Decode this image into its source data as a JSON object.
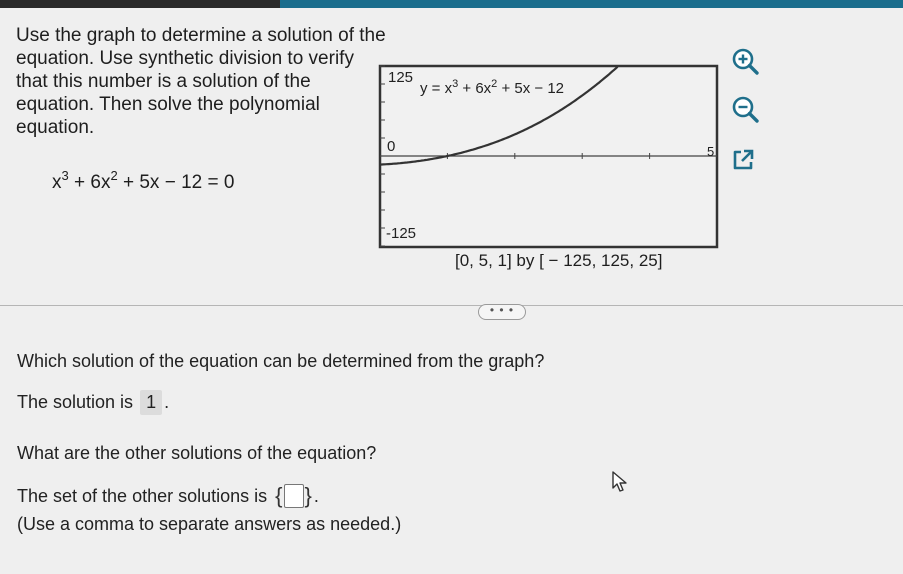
{
  "problem": {
    "instruction": "Use the graph to determine a solution of the equation. Use synthetic division to verify that this number is a solution of the equation. Then solve the polynomial equation.",
    "equation_parts": [
      "x",
      "3",
      " + 6x",
      "2",
      " + 5x − 12 = 0"
    ]
  },
  "graph": {
    "function_label_parts": [
      "y = x",
      "3",
      " + 6x",
      "2",
      " + 5x − 12"
    ],
    "y_max_label": "125",
    "y_zero_label": "0",
    "y_min_label": "-125",
    "x_max_label": "5",
    "window_label": "[0, 5, 1]  by  [ − 125, 125, 25]",
    "window": {
      "xmin": 0,
      "xmax": 5,
      "xscl": 1,
      "ymin": -125,
      "ymax": 125,
      "yscl": 25
    }
  },
  "toolbar": {
    "zoom_in": "zoom-in-icon",
    "zoom_out": "zoom-out-icon",
    "popout": "external-link-icon"
  },
  "more_button": "• • •",
  "question1": {
    "text": "Which solution of the equation can be determined from the graph?",
    "answer_prefix": "The solution is",
    "answer_value": "1",
    "answer_suffix": "."
  },
  "question2": {
    "text": "What are the other solutions of the equation?",
    "answer_prefix": "The set of the other solutions is",
    "set_open": "{",
    "set_close": "}",
    "answer_suffix": ".",
    "input_value": "",
    "hint": "(Use a comma to separate answers as needed.)"
  },
  "colors": {
    "accent": "#1a6d8c",
    "curve": "#333333",
    "answer_bg": "#dcdcdc"
  }
}
